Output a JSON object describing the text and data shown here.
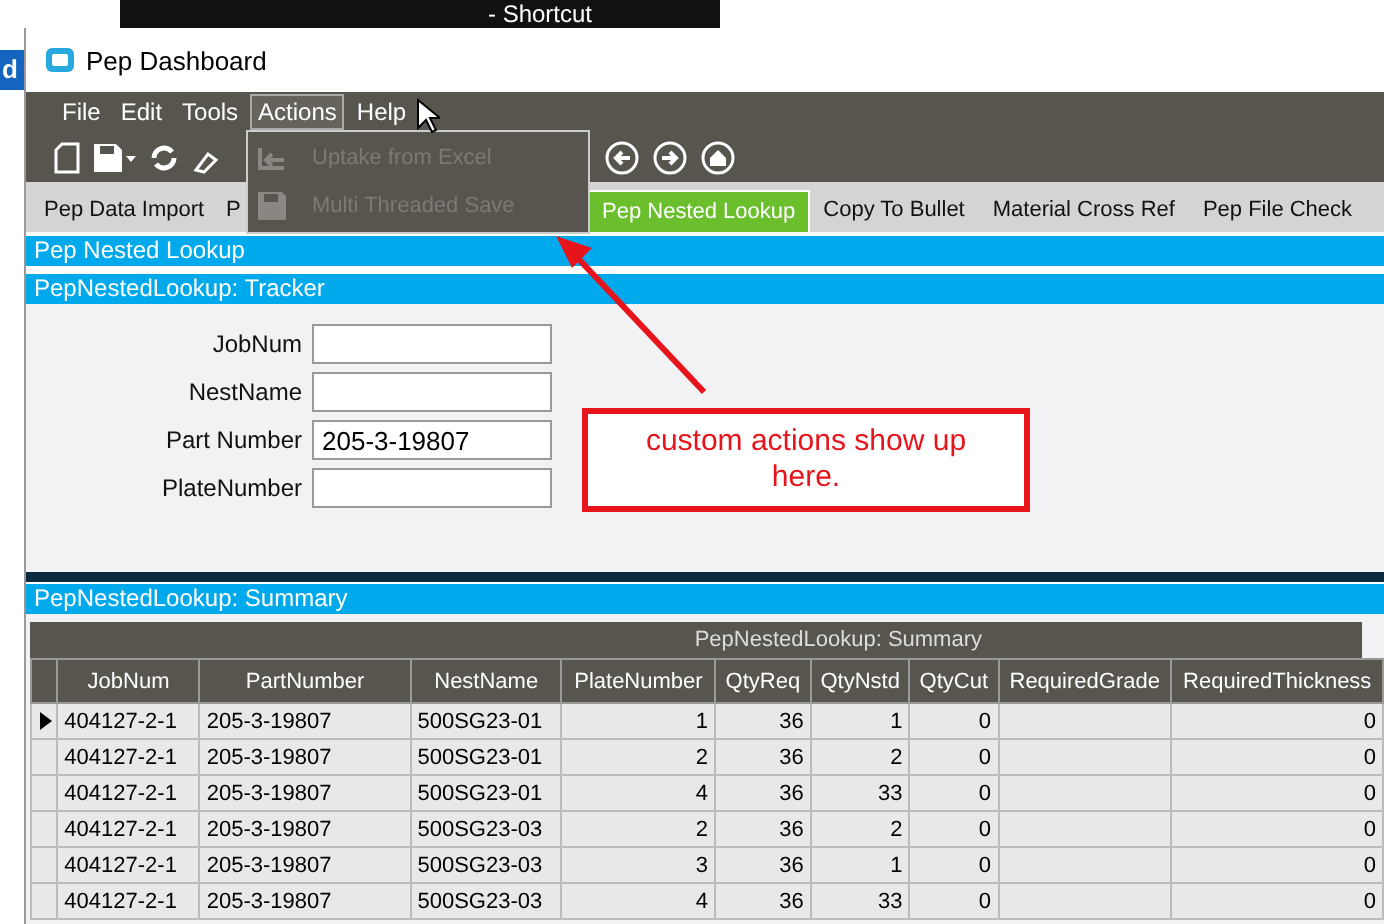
{
  "desktop": {
    "shortcut_label": "- Shortcut",
    "side_fragment": "d"
  },
  "window": {
    "title": "Pep Dashboard"
  },
  "menu": [
    {
      "label": "File",
      "open": false
    },
    {
      "label": "Edit",
      "open": false
    },
    {
      "label": "Tools",
      "open": false
    },
    {
      "label": "Actions",
      "open": true
    },
    {
      "label": "Help",
      "open": false
    }
  ],
  "dropdown": [
    {
      "label": "Uptake from Excel",
      "disabled": true,
      "kind": "import"
    },
    {
      "label": "Multi Threaded Save",
      "disabled": true,
      "kind": "save"
    }
  ],
  "tabs": [
    {
      "label": "Pep Data Import",
      "selected": false
    },
    {
      "label": "P",
      "selected": false
    },
    {
      "label": "Pep Nested Lookup",
      "selected": true
    },
    {
      "label": "Copy To Bullet",
      "selected": false
    },
    {
      "label": "Material Cross Ref",
      "selected": false
    },
    {
      "label": "Pep File Check",
      "selected": false
    }
  ],
  "page_title": "Pep Nested Lookup",
  "tracker": {
    "title": "PepNestedLookup: Tracker",
    "fields": [
      {
        "label": "JobNum"
      },
      {
        "label": "NestName"
      },
      {
        "label": "Part Number",
        "value": "205-3-19807"
      },
      {
        "label": "PlateNumber"
      }
    ]
  },
  "callout": "custom actions show up here.",
  "summary": {
    "title": "PepNestedLookup: Summary",
    "grid_caption": "PepNestedLookup: Summary",
    "columns": [
      "JobNum",
      "PartNumber",
      "NestName",
      "PlateNumber",
      "QtyReq",
      "QtyNstd",
      "QtyCut",
      "RequiredGrade",
      "RequiredThickness"
    ],
    "rows": [
      {
        "selected": true,
        "cells": [
          "404127-2-1",
          "205-3-19807",
          "500SG23-01",
          "1",
          "36",
          "1",
          "0",
          "",
          "0"
        ]
      },
      {
        "selected": false,
        "cells": [
          "404127-2-1",
          "205-3-19807",
          "500SG23-01",
          "2",
          "36",
          "2",
          "0",
          "",
          "0"
        ]
      },
      {
        "selected": false,
        "cells": [
          "404127-2-1",
          "205-3-19807",
          "500SG23-01",
          "4",
          "36",
          "33",
          "0",
          "",
          "0"
        ]
      },
      {
        "selected": false,
        "cells": [
          "404127-2-1",
          "205-3-19807",
          "500SG23-03",
          "2",
          "36",
          "2",
          "0",
          "",
          "0"
        ]
      },
      {
        "selected": false,
        "cells": [
          "404127-2-1",
          "205-3-19807",
          "500SG23-03",
          "3",
          "36",
          "1",
          "0",
          "",
          "0"
        ]
      },
      {
        "selected": false,
        "cells": [
          "404127-2-1",
          "205-3-19807",
          "500SG23-03",
          "4",
          "36",
          "33",
          "0",
          "",
          "0"
        ]
      }
    ]
  }
}
